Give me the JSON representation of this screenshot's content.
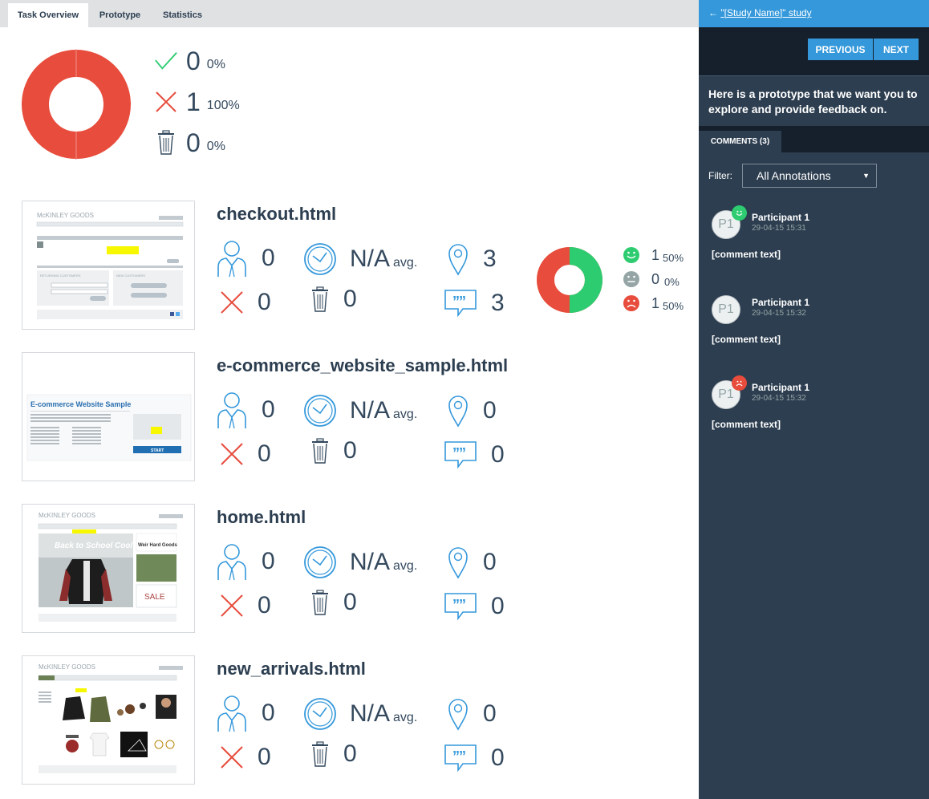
{
  "tabs": [
    {
      "label": "Task Overview",
      "active": true
    },
    {
      "label": "Prototype",
      "active": false
    },
    {
      "label": "Statistics",
      "active": false
    }
  ],
  "summary": {
    "success": {
      "count": "0",
      "pct": "0%"
    },
    "fail": {
      "count": "1",
      "pct": "100%"
    },
    "abandon": {
      "count": "0",
      "pct": "0%"
    },
    "donut_fraction_fail": 1.0,
    "colors": {
      "fail": "#e74c3c",
      "success": "#2ecc71"
    }
  },
  "tasks": [
    {
      "title": "checkout.html",
      "participants": "0",
      "time": "N/A",
      "avg": "avg.",
      "pins": "3",
      "failed": "0",
      "abandoned": "0",
      "comments": "3",
      "sentiment": {
        "positive": {
          "count": "1",
          "pct": "50%"
        },
        "neutral": {
          "count": "0",
          "pct": "0%"
        },
        "negative": {
          "count": "1",
          "pct": "50%"
        },
        "positive_fraction": 0.5
      }
    },
    {
      "title": "e-commerce_website_sample.html",
      "participants": "0",
      "time": "N/A",
      "avg": "avg.",
      "pins": "0",
      "failed": "0",
      "abandoned": "0",
      "comments": "0",
      "thumb": {
        "heading": "E-commerce Website Sample",
        "button": "START"
      }
    },
    {
      "title": "home.html",
      "participants": "0",
      "time": "N/A",
      "avg": "avg.",
      "pins": "0",
      "failed": "0",
      "abandoned": "0",
      "comments": "0",
      "thumb": {
        "logo": "McKINLEY GOODS",
        "banner": "Back to School Cool",
        "side": "Weir Hard Goods",
        "sale": "SALE"
      }
    },
    {
      "title": "new_arrivals.html",
      "participants": "0",
      "time": "N/A",
      "avg": "avg.",
      "pins": "0",
      "failed": "0",
      "abandoned": "0",
      "comments": "0",
      "thumb": {
        "logo": "McKINLEY GOODS"
      }
    }
  ],
  "thumb_checkout": {
    "logo": "McKINLEY GOODS",
    "heading_left": "RETURNING CUSTOMERS",
    "heading_right": "NEW CUSTOMERS"
  },
  "side": {
    "back_label": "\"[Study Name]\" study",
    "back_arrow": "←",
    "prev_label": "PREVIOUS",
    "next_label": "NEXT",
    "intro": "Here is a prototype that we want you to explore and provide feedback on.",
    "comments_tab": "COMMENTS (3)",
    "filter_label": "Filter:",
    "filter_value": "All Annotations",
    "comments": [
      {
        "avatar": "P1",
        "name": "Participant 1",
        "time": "29-04-15 15:31",
        "text": "[comment text]",
        "mood": "positive"
      },
      {
        "avatar": "P1",
        "name": "Participant 1",
        "time": "29-04-15 15:32",
        "text": "[comment text]",
        "mood": "none"
      },
      {
        "avatar": "P1",
        "name": "Participant 1",
        "time": "29-04-15 15:32",
        "text": "[comment text]",
        "mood": "negative"
      }
    ]
  }
}
